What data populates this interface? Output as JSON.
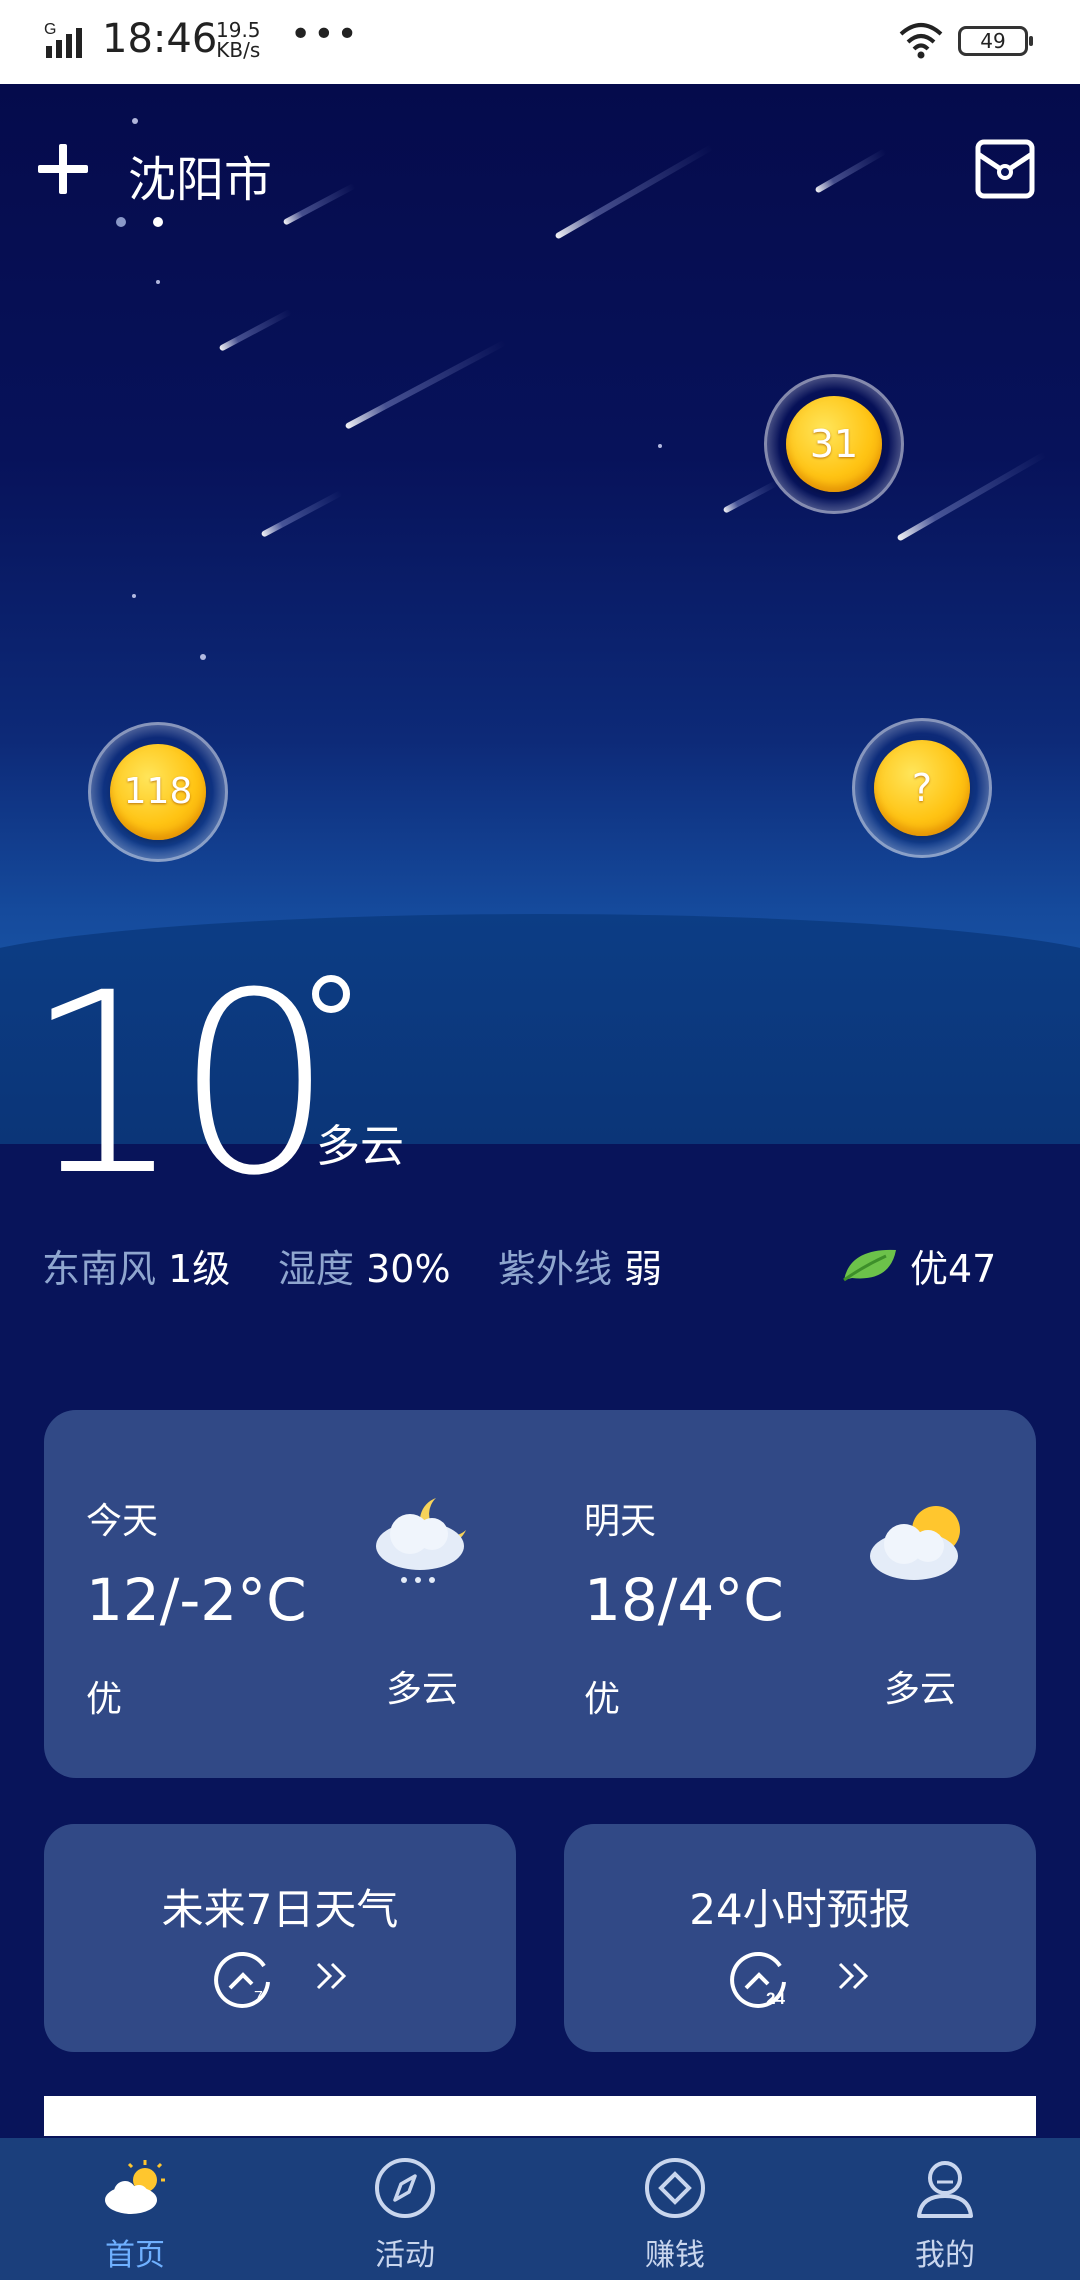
{
  "status_bar": {
    "network": "G",
    "time": "18:46",
    "speed_value": "19.5",
    "speed_unit": "KB/s",
    "more": "•••",
    "battery": "49"
  },
  "header": {
    "city": "沈阳市",
    "add_icon": "plus-icon",
    "mail_icon": "envelope-icon"
  },
  "coins": [
    {
      "label": "31"
    },
    {
      "label": "118"
    },
    {
      "label": "?"
    }
  ],
  "current": {
    "temperature": "10",
    "condition": "多云",
    "wind_label": "东南风",
    "wind_value": "1级",
    "humidity_label": "湿度",
    "humidity_value": "30%",
    "uv_label": "紫外线",
    "uv_value": "弱",
    "aqi": "优47",
    "aqi_color": "#6cc24a"
  },
  "forecast": [
    {
      "day": "今天",
      "range": "12/-2°C",
      "aqi": "优",
      "condition": "多云",
      "icon": "moon-cloud-snow-icon"
    },
    {
      "day": "明天",
      "range": "18/4°C",
      "aqi": "优",
      "condition": "多云",
      "icon": "sun-cloud-icon"
    }
  ],
  "buttons": {
    "seven_day": "未来7日天气",
    "hourly": "24小时预报",
    "seven_day_badge": "7",
    "hourly_badge": "24"
  },
  "nav": [
    {
      "label": "首页",
      "icon": "weather-home-icon",
      "active": true
    },
    {
      "label": "活动",
      "icon": "compass-icon",
      "active": false
    },
    {
      "label": "赚钱",
      "icon": "diamond-icon",
      "active": false
    },
    {
      "label": "我的",
      "icon": "user-icon",
      "active": false
    }
  ],
  "colors": {
    "nav_active": "#6fb0ff",
    "nav_inactive": "#c9d6ee"
  }
}
